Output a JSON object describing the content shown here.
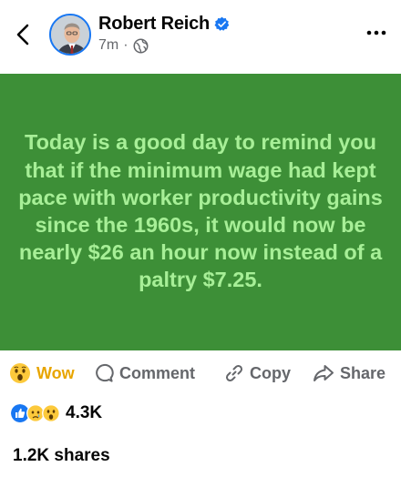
{
  "header": {
    "author_name": "Robert Reich",
    "timestamp": "7m",
    "separator": "·",
    "audience_icon": "globe-icon",
    "back_icon": "chevron-left-icon",
    "more_icon": "more-horizontal-icon",
    "verified_icon": "verified-badge-icon",
    "verified_color": "#1877f2"
  },
  "post": {
    "text": "Today is a good day to remind you that if the minimum wage had kept pace with worker productivity gains since the 1960s, it would now be nearly $26 an hour now instead of a paltry $7.25.",
    "background_color": "#3d8f37",
    "text_color": "#a7ef97"
  },
  "actions": {
    "wow_label": "Wow",
    "comment_label": "Comment",
    "copy_label": "Copy",
    "share_label": "Share",
    "wow_color": "#e8a500"
  },
  "reactions": {
    "icons": [
      "like-icon",
      "sad-icon",
      "wow-icon"
    ],
    "count": "4.3K"
  },
  "shares": {
    "label": "1.2K shares"
  }
}
